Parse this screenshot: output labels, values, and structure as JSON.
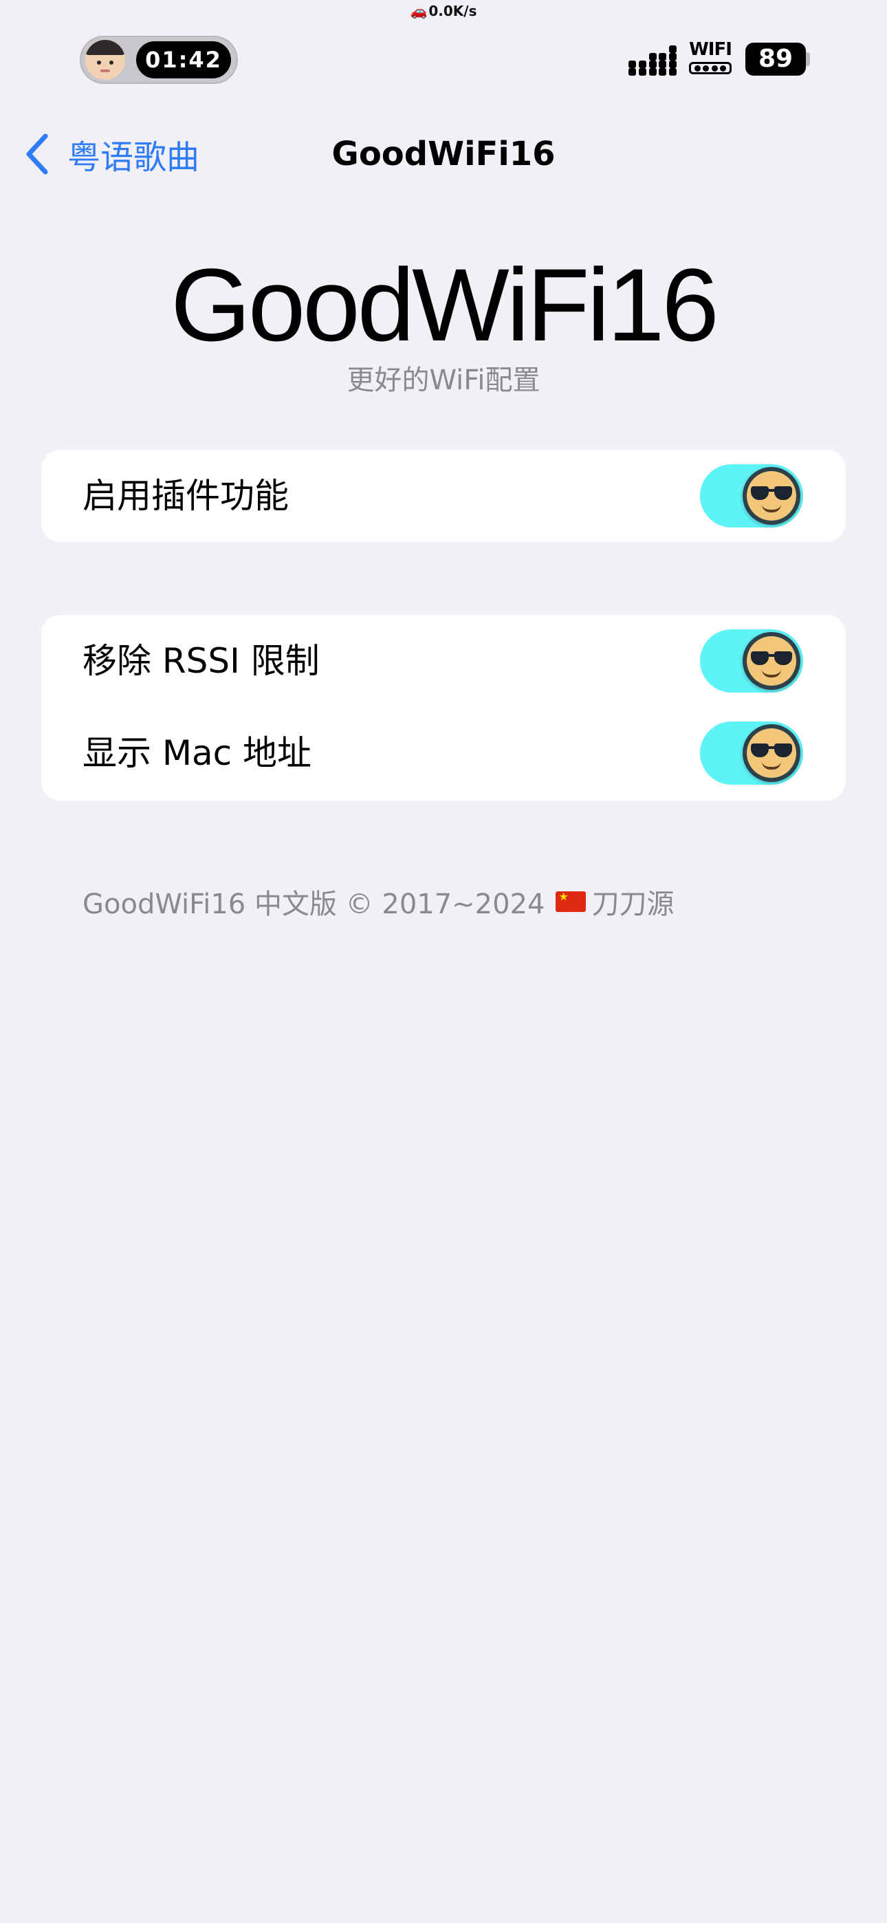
{
  "status_bar": {
    "net_speed": "0.0K/s",
    "time": "01:42",
    "wifi_label": "WIFI",
    "battery": "89"
  },
  "nav": {
    "back_label": "粤语歌曲",
    "title": "GoodWiFi16"
  },
  "header": {
    "title": "GoodWiFi16",
    "subtitle": "更好的WiFi配置"
  },
  "settings": {
    "group1": [
      {
        "label": "启用插件功能",
        "enabled": true
      }
    ],
    "group2": [
      {
        "label": "移除 RSSI 限制",
        "enabled": true
      },
      {
        "label": "显示 Mac 地址",
        "enabled": true
      }
    ]
  },
  "footer": {
    "text": "GoodWiFi16 中文版 © 2017~2024",
    "flag_icon": "china-flag-icon",
    "author": "刀刀源"
  },
  "colors": {
    "background": "#f1f0f6",
    "accent": "#2f7cf6",
    "toggle_on": "#5ef3f7",
    "secondary_text": "#8a8a8e"
  }
}
